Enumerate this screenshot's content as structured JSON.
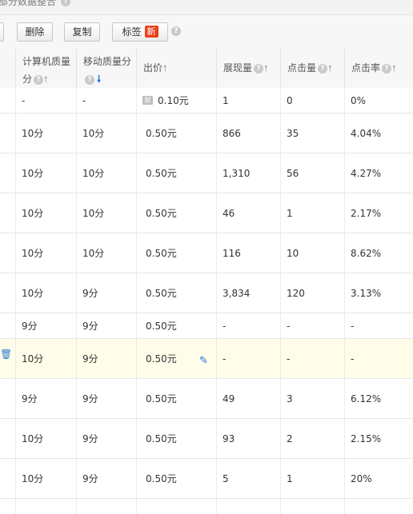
{
  "top_note": {
    "text": "部分数据整合"
  },
  "toolbar": {
    "delete_label": "删除",
    "copy_label": "复制",
    "tag_label": "标签",
    "tag_badge": "新"
  },
  "columns": {
    "pc_quality": {
      "line1": "计算机质量",
      "line2": "分"
    },
    "mobile_quality": {
      "label": "移动质量分"
    },
    "bid": {
      "label": "出价"
    },
    "impressions": {
      "label": "展现量"
    },
    "clicks": {
      "label": "点击量"
    },
    "ctr": {
      "label": "点击率"
    }
  },
  "rows": [
    {
      "pc": "-",
      "mobile": "-",
      "bid": "0.10元",
      "imp": "1",
      "clk": "0",
      "ctr": "0%"
    },
    {
      "pc": "10分",
      "mobile": "10分",
      "bid": "0.50元",
      "imp": "866",
      "clk": "35",
      "ctr": "4.04%"
    },
    {
      "pc": "10分",
      "mobile": "10分",
      "bid": "0.50元",
      "imp": "1,310",
      "clk": "56",
      "ctr": "4.27%"
    },
    {
      "pc": "10分",
      "mobile": "10分",
      "bid": "0.50元",
      "imp": "46",
      "clk": "1",
      "ctr": "2.17%"
    },
    {
      "pc": "10分",
      "mobile": "10分",
      "bid": "0.50元",
      "imp": "116",
      "clk": "10",
      "ctr": "8.62%"
    },
    {
      "pc": "10分",
      "mobile": "9分",
      "bid": "0.50元",
      "imp": "3,834",
      "clk": "120",
      "ctr": "3.13%"
    },
    {
      "pc": "9分",
      "mobile": "9分",
      "bid": "0.50元",
      "imp": "-",
      "clk": "-",
      "ctr": "-"
    },
    {
      "pc": "10分",
      "mobile": "9分",
      "bid": "0.50元",
      "imp": "-",
      "clk": "-",
      "ctr": "-"
    },
    {
      "pc": "9分",
      "mobile": "9分",
      "bid": "0.50元",
      "imp": "49",
      "clk": "3",
      "ctr": "6.12%"
    },
    {
      "pc": "10分",
      "mobile": "9分",
      "bid": "0.50元",
      "imp": "93",
      "clk": "2",
      "ctr": "2.15%"
    },
    {
      "pc": "10分",
      "mobile": "9分",
      "bid": "0.50元",
      "imp": "5",
      "clk": "1",
      "ctr": "20%"
    }
  ]
}
